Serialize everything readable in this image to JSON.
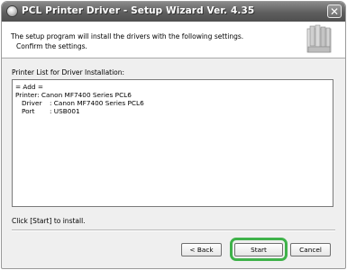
{
  "window": {
    "title": "PCL Printer Driver - Setup Wizard Ver. 4.35",
    "close_glyph": "✕"
  },
  "header": {
    "line1": "The setup program will install the drivers with the following settings.",
    "line2": "Confirm the settings."
  },
  "list": {
    "label": "Printer List for Driver Installation:",
    "rows": [
      "= Add =",
      "Printer: Canon MF7400 Series PCL6"
    ],
    "details": [
      {
        "key": "Driver",
        "value": ": Canon MF7400 Series PCL6"
      },
      {
        "key": "Port",
        "value": ": USB001"
      }
    ]
  },
  "status": "Click [Start] to install.",
  "buttons": {
    "back": "< Back",
    "start": "Start",
    "cancel": "Cancel"
  },
  "colors": {
    "highlight": "#3fb24a",
    "titlebar": "#5e5e5e"
  },
  "icons": [
    "app-icon",
    "close-icon",
    "printer-cartridge-logo"
  ]
}
